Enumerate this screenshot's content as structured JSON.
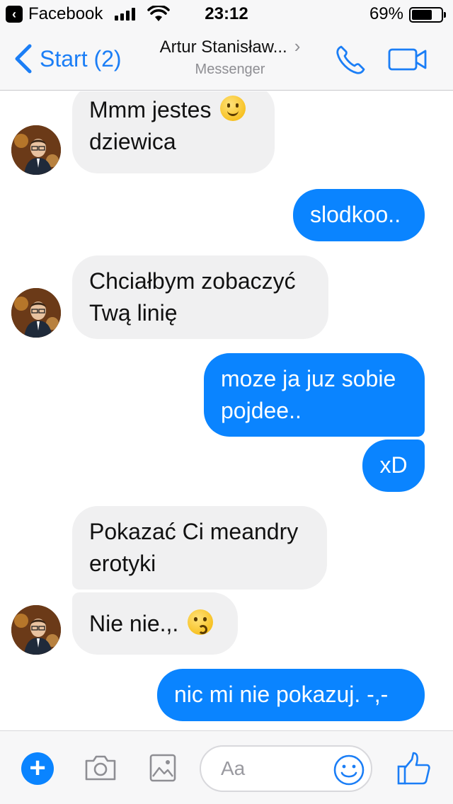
{
  "status_bar": {
    "back_app": "Facebook",
    "time": "23:12",
    "battery_percent": "69%",
    "battery_level": 0.69,
    "signal_bars": 4
  },
  "nav": {
    "back_label": "Start (2)",
    "title": "Artur Stanisław...",
    "subtitle": "Messenger",
    "call_icon": "phone-icon",
    "video_icon": "video-camera-icon"
  },
  "messages": [
    {
      "id": "m1",
      "sender": "contact",
      "lines": [
        "Mmm jestes",
        "dziewica"
      ],
      "emoji": "slightly-smiling-face"
    },
    {
      "id": "m2",
      "sender": "me",
      "lines": [
        "slodkoo.."
      ]
    },
    {
      "id": "m3",
      "sender": "contact",
      "lines": [
        "Chciałbym zobaczyć",
        "Twą linię"
      ]
    },
    {
      "id": "m4",
      "sender": "me",
      "lines": [
        "moze ja juz sobie",
        "pojdee.."
      ]
    },
    {
      "id": "m5",
      "sender": "me",
      "lines": [
        "xD"
      ]
    },
    {
      "id": "m6",
      "sender": "contact",
      "lines": [
        "Pokazać Ci meandry",
        "erotyki"
      ]
    },
    {
      "id": "m7",
      "sender": "contact",
      "lines": [
        "Nie nie.,."
      ],
      "emoji": "kissing-face"
    },
    {
      "id": "m8",
      "sender": "me",
      "lines": [
        "nic mi nie pokazuj. -,-"
      ]
    }
  ],
  "composer": {
    "placeholder": "Aa",
    "icons": [
      "plus-icon",
      "camera-icon",
      "image-icon",
      "emoji-icon",
      "thumbs-up-icon"
    ]
  },
  "colors": {
    "accent": "#0a84ff",
    "incoming_bubble": "#f0f0f1",
    "bar_background": "#f7f7f8"
  }
}
